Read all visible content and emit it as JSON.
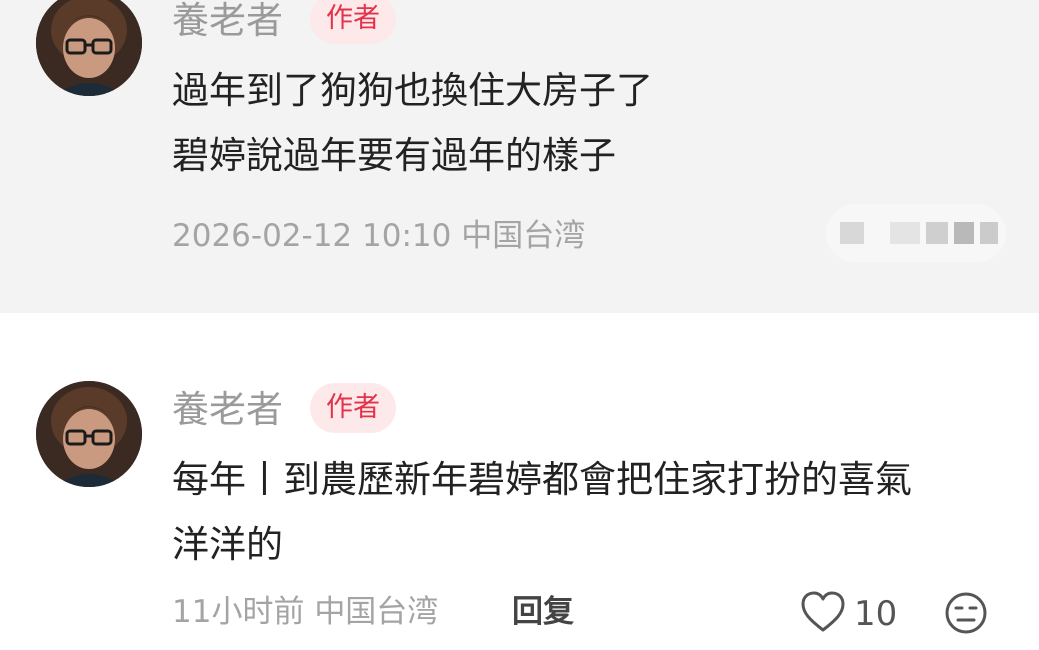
{
  "comments": [
    {
      "author": "養老者",
      "badge": "作者",
      "text_lines": [
        "過年到了狗狗也換住大房子了",
        "碧婷說過年要有過年的樣子"
      ],
      "timestamp": "2026-02-12 10:10",
      "location": "中国台湾",
      "avatar_icon": "avatar-man-glasses",
      "actions_blurred": true
    },
    {
      "author": "養老者",
      "badge": "作者",
      "text_lines": [
        "每年丨到農歷新年碧婷都會把住家打扮的喜氣",
        "洋洋的"
      ],
      "timestamp": "11小时前",
      "location": "中国台湾",
      "reply_label": "回复",
      "like_count": "10",
      "like_icon": "heart-outline-icon",
      "emoji_icon": "emoji-face-icon",
      "avatar_icon": "avatar-man-glasses"
    }
  ],
  "colors": {
    "badge_bg": "#fde8ea",
    "badge_text": "#e3324a",
    "highlight_bg": "#f3f3f3",
    "meta_text": "#a4a4a4",
    "body_text": "#222222"
  }
}
